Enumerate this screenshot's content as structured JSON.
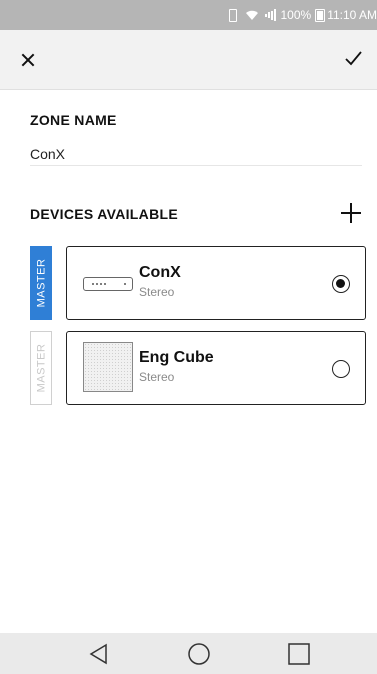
{
  "status_bar": {
    "battery": "100%",
    "time": "11:10 AM",
    "icons": [
      "vibrate-icon",
      "wifi-icon",
      "signal-icon",
      "battery-icon"
    ]
  },
  "app_bar": {
    "close_icon": "close-icon",
    "confirm_icon": "checkmark-icon"
  },
  "zone": {
    "label": "ZONE NAME",
    "value": "ConX"
  },
  "devices": {
    "label": "DEVICES AVAILABLE",
    "add_icon": "plus-icon",
    "items": [
      {
        "name": "ConX",
        "subtitle": "Stereo",
        "master_label": "MASTER",
        "is_master": true,
        "selected": true
      },
      {
        "name": "Eng Cube",
        "subtitle": "Stereo",
        "master_label": "MASTER",
        "is_master": false,
        "selected": false
      }
    ]
  },
  "colors": {
    "accent": "#2f7fd6",
    "status_bar": "#b5b5b5",
    "app_bar": "#f2f2f2"
  },
  "nav_bar": {
    "icons": [
      "back-icon",
      "home-icon",
      "recent-apps-icon"
    ]
  }
}
